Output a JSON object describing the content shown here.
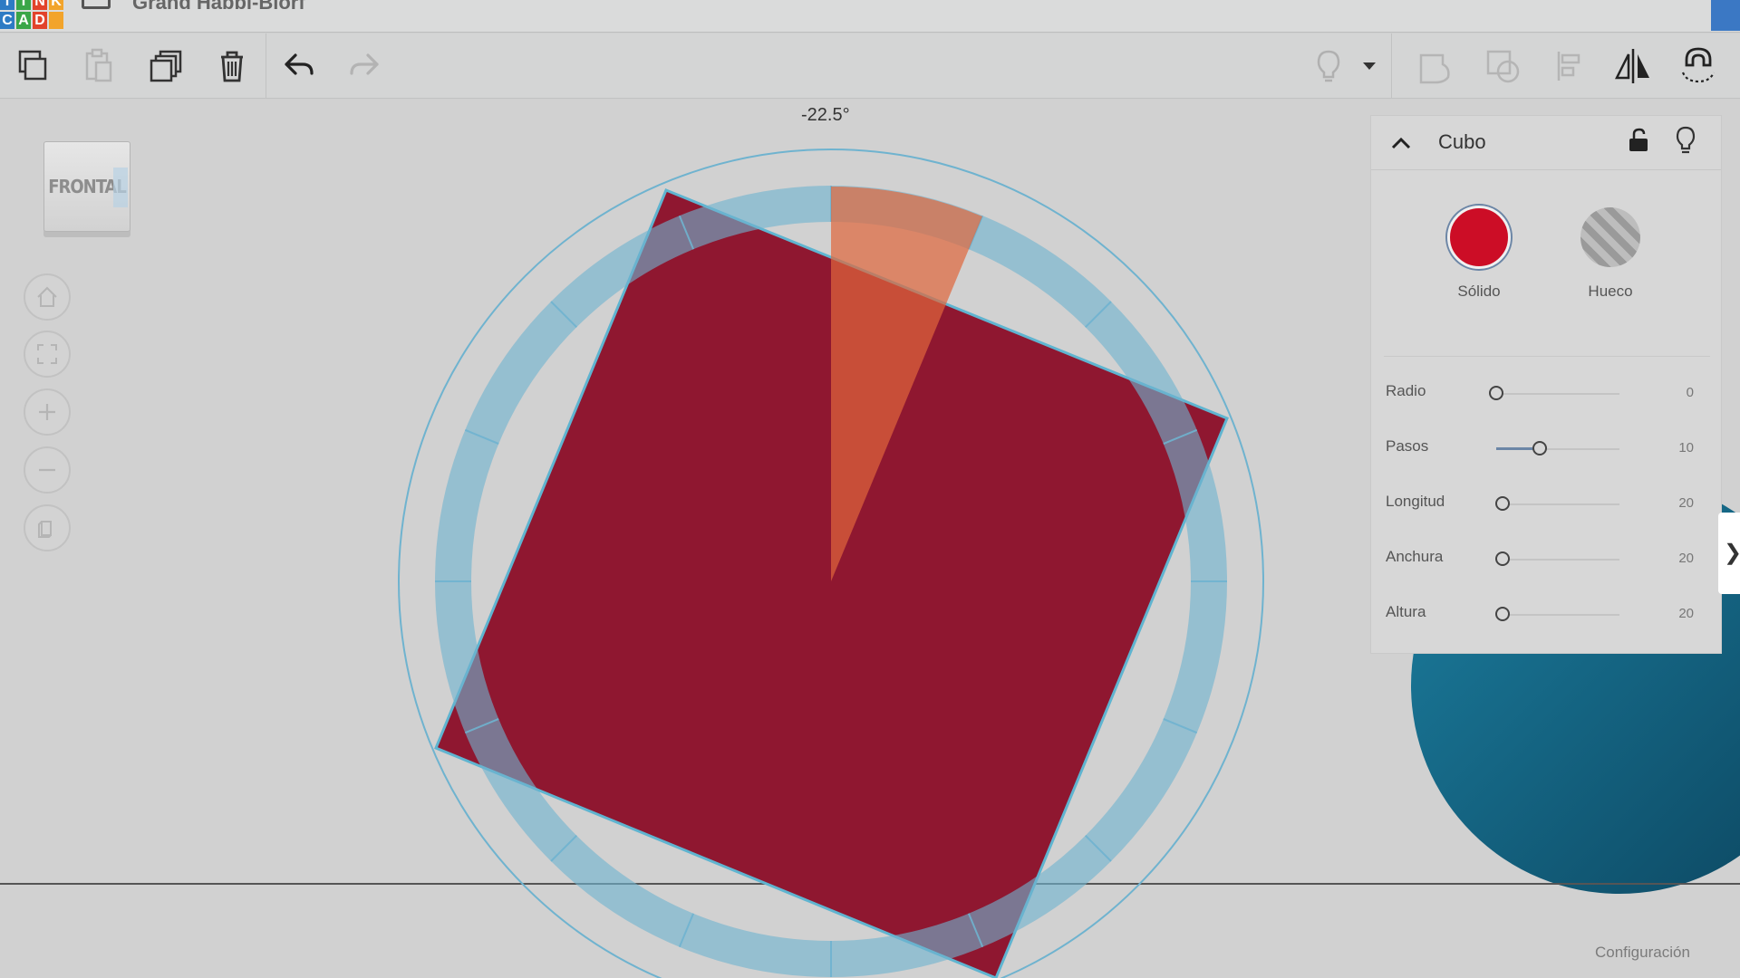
{
  "app": {
    "logo_letters": [
      "T",
      "I",
      "N",
      "K",
      "C",
      "A",
      "D",
      ""
    ],
    "logo_colors": [
      "#2e7bc4",
      "#3aa648",
      "#e2432b",
      "#f2a42b",
      "#2e7bc4",
      "#3aa648",
      "#e2432b",
      "#f2a42b"
    ],
    "title": "Grand Habbi-Blorf",
    "accent": "#3b78c4"
  },
  "toolbar": {
    "items": [
      {
        "name": "copy",
        "icon": "copy-icon",
        "enabled": true
      },
      {
        "name": "paste",
        "icon": "paste-icon",
        "enabled": false
      },
      {
        "name": "duplicate",
        "icon": "duplicate-icon",
        "enabled": true
      },
      {
        "name": "delete",
        "icon": "trash-icon",
        "enabled": true
      },
      {
        "name": "undo",
        "icon": "undo-icon",
        "enabled": true
      },
      {
        "name": "redo",
        "icon": "redo-icon",
        "enabled": false
      },
      {
        "name": "visibility",
        "icon": "lightbulb-icon",
        "enabled": false
      },
      {
        "name": "visibility-menu",
        "icon": "caret-down-icon",
        "enabled": true
      },
      {
        "name": "group",
        "icon": "group-icon",
        "enabled": false
      },
      {
        "name": "ungroup",
        "icon": "ungroup-icon",
        "enabled": false
      },
      {
        "name": "align",
        "icon": "align-icon",
        "enabled": false
      },
      {
        "name": "mirror",
        "icon": "mirror-icon",
        "enabled": true
      },
      {
        "name": "magnet",
        "icon": "magnet-icon",
        "enabled": true
      }
    ]
  },
  "viewcube": {
    "label": "FRONTAL"
  },
  "nav_buttons": [
    "home-icon",
    "fit-view-icon",
    "zoom-in-icon",
    "zoom-out-icon",
    "perspective-icon"
  ],
  "rotation": {
    "angle_label": "-22.5°",
    "angle_value": -22.5,
    "shape_color": "#8f1730",
    "ring_color": "#6fb3cf",
    "wedge_color": "#e0673c"
  },
  "inspector": {
    "title": "Cubo",
    "solid_label": "Sólido",
    "hollow_label": "Hueco",
    "solid_color": "#cc0d26",
    "params": [
      {
        "label": "Radio",
        "value": "0",
        "fraction": 0.0
      },
      {
        "label": "Pasos",
        "value": "10",
        "fraction": 0.35
      },
      {
        "label": "Longitud",
        "value": "20",
        "fraction": 0.05
      },
      {
        "label": "Anchura",
        "value": "20",
        "fraction": 0.05
      },
      {
        "label": "Altura",
        "value": "20",
        "fraction": 0.05
      }
    ]
  },
  "footer": {
    "settings_label": "Configuración"
  }
}
